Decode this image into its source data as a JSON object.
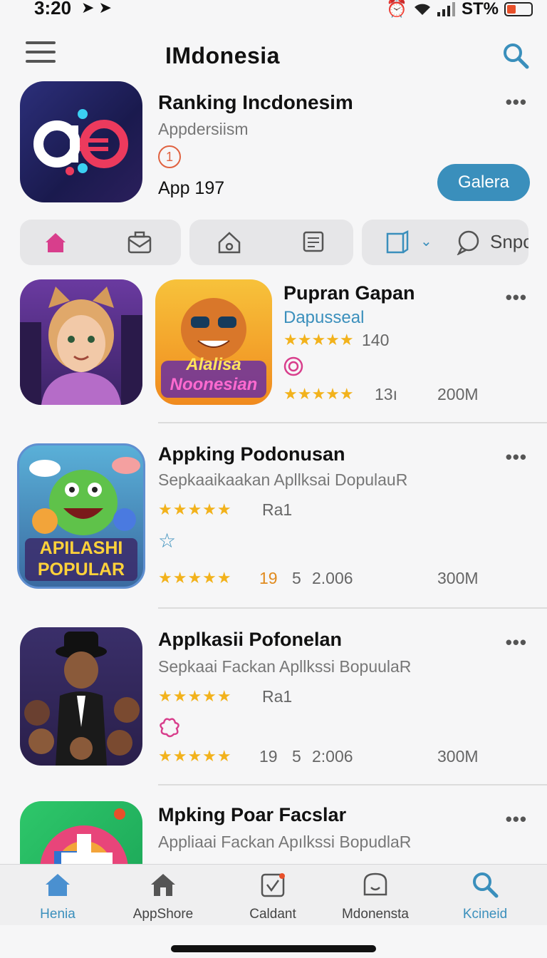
{
  "status_bar": {
    "time": "3:20",
    "battery_text": "ST%"
  },
  "header": {
    "title": "IMdonesia"
  },
  "featured": {
    "name": "Ranking Incdonesim",
    "subtitle": "Appdersiism",
    "rank": "1",
    "meta": "App 197",
    "button": "Galera",
    "more": "•••"
  },
  "chips": {
    "third_label": "Snpc"
  },
  "apps": [
    {
      "name": "Pupran Gapan",
      "developer": "Dapusseal",
      "rating_count": "140",
      "rating2_count": "13ı",
      "size": "200M",
      "art_text": [
        "Alalisa",
        "Noonesian"
      ],
      "more": "•••"
    },
    {
      "name": "Appking Podonusan",
      "description": "Sepkaaikaakan Apllksai DopulauR",
      "rating_label": "Ra1",
      "count_a": "19",
      "count_b": "5",
      "count_c": "2.006",
      "size": "300M",
      "art_text": [
        "APILASHI",
        "POPULAR"
      ],
      "more": "•••"
    },
    {
      "name": "Applkasii Pofonelan",
      "description": "Sepkaai Fackan Apllkssi BopuulaR",
      "rating_label": "Ra1",
      "count_a": "19",
      "count_b": "5",
      "count_c": "2:006",
      "size": "300M",
      "more": "•••"
    },
    {
      "name": "Mpking Poar Facslar",
      "description": "Appliaai Fackan Apılkssi BopudlaR",
      "more": "•••"
    }
  ],
  "tabs": [
    {
      "label": "Henia"
    },
    {
      "label": "AppShore"
    },
    {
      "label": "Caldant"
    },
    {
      "label": "Mdonensta"
    },
    {
      "label": "Kcineid"
    }
  ],
  "colors": {
    "accent": "#3a8fbc",
    "star": "#f2b21c",
    "tab_active": "#3a8fbc"
  }
}
